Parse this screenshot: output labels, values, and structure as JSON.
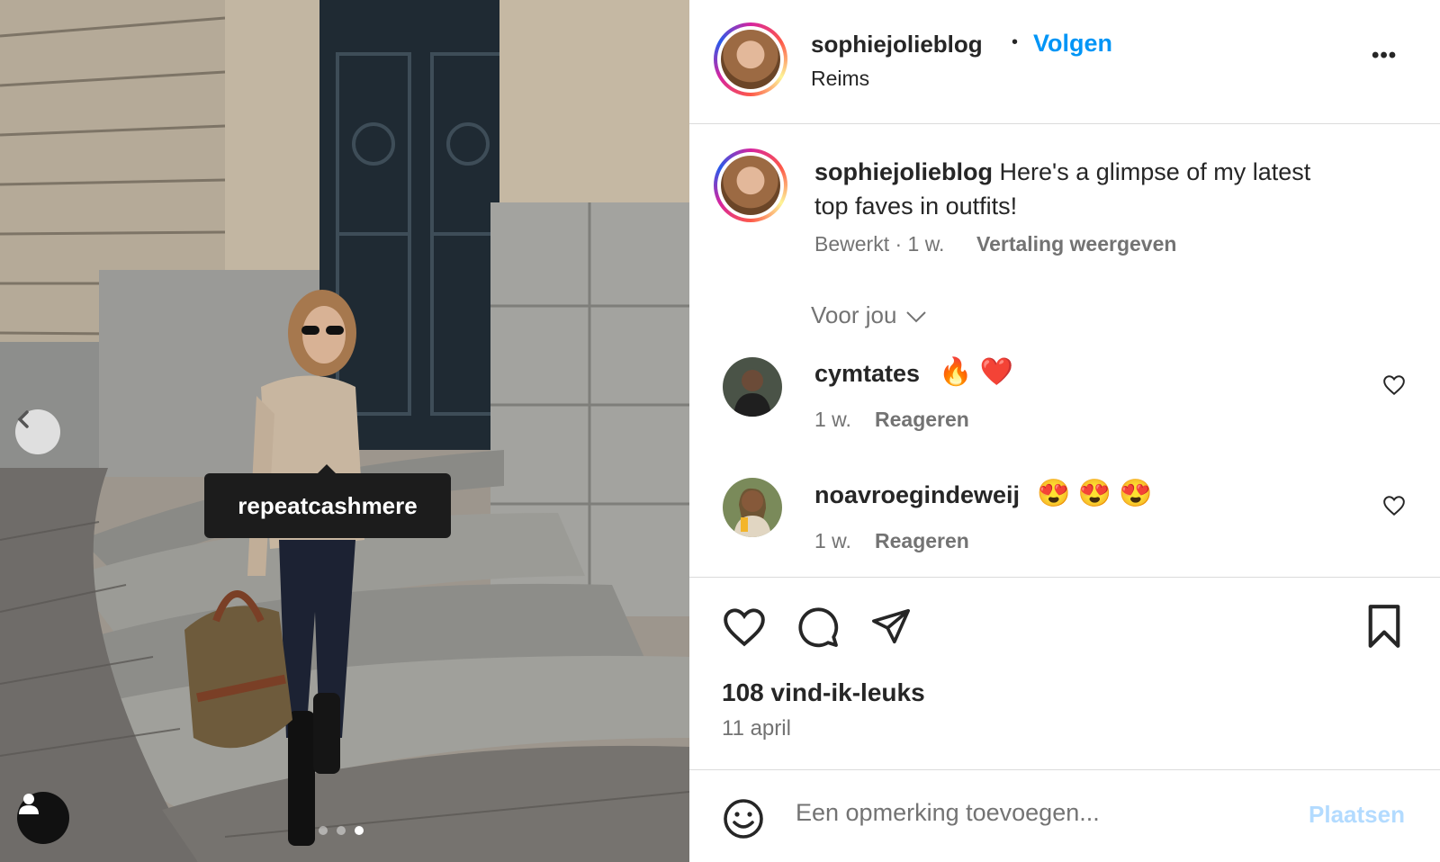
{
  "post": {
    "image_tag": "repeatcashmere",
    "carousel_count": 3,
    "carousel_active": 3
  },
  "header": {
    "username": "sophiejolieblog",
    "separator": "•",
    "follow_label": "Volgen",
    "location": "Reims",
    "more_label": "•••"
  },
  "caption": {
    "username": "sophiejolieblog",
    "text_line1": "Here's a glimpse of my latest",
    "text_line2": "top faves in outfits!",
    "edited": "Bewerkt · 1 w.",
    "translate_label": "Vertaling weergeven"
  },
  "filter": {
    "label": "Voor jou"
  },
  "comments": [
    {
      "username": "cymtates",
      "text": "🔥 ❤️",
      "time": "1 w.",
      "reply_label": "Reageren"
    },
    {
      "username": "noavroegindeweij",
      "text": "😍 😍 😍",
      "time": "1 w.",
      "reply_label": "Reageren"
    }
  ],
  "stats": {
    "likes": "108 vind-ik-leuks",
    "date": "11 april"
  },
  "composer": {
    "placeholder": "Een opmerking toevoegen...",
    "post_label": "Plaatsen"
  },
  "colors": {
    "link_blue": "#0095f6",
    "post_disabled": "#b3dbff",
    "muted": "#737373",
    "text": "#262626"
  }
}
